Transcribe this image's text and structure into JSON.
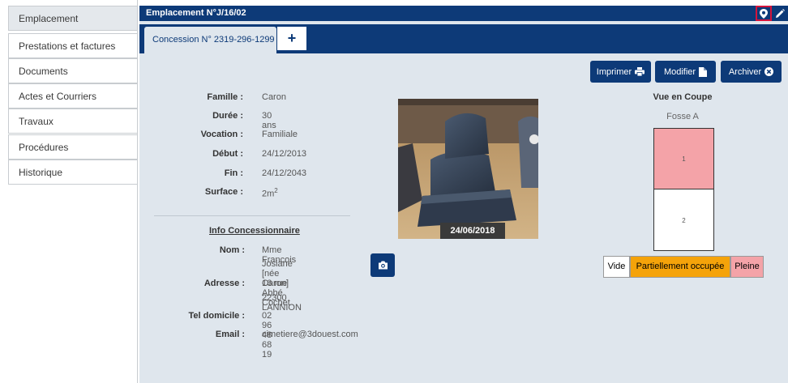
{
  "sidebar": {
    "items": [
      {
        "label": "Emplacement",
        "active": true
      },
      {
        "label": "Prestations et factures"
      },
      {
        "label": "Documents"
      },
      {
        "label": "Actes et Courriers"
      },
      {
        "label": "Travaux"
      },
      {
        "label": "Procédures"
      },
      {
        "label": "Historique"
      }
    ]
  },
  "header": {
    "title": "Emplacement N°J/16/02",
    "icons": [
      "map-pin-icon",
      "pencil-icon"
    ]
  },
  "tabs": {
    "active_label": "Concession N° 2319-296-1299",
    "add_label": "+"
  },
  "toolbar": {
    "print_label": "Imprimer",
    "edit_label": "Modifier",
    "archive_label": "Archiver"
  },
  "concession": {
    "famille_label": "Famille :",
    "famille": "Caron",
    "duree_label": "Durée :",
    "duree": "30 ans",
    "vocation_label": "Vocation :",
    "vocation": "Familiale",
    "debut_label": "Début :",
    "debut": "24/12/2013",
    "fin_label": "Fin :",
    "fin": "24/12/2043",
    "surface_label": "Surface :",
    "surface": "2m",
    "surface_exp": "2"
  },
  "concessionnaire": {
    "section_title": "Info Concessionnaire",
    "nom_label": "Nom :",
    "nom_line1": "Mme Francois",
    "nom_line2": "Josiane [née Caron]",
    "adresse_label": "Adresse :",
    "adresse_line1": "16 rue Abbé Cochet",
    "adresse_line2": "22300 LANNION",
    "tel_label": "Tel domicile :",
    "tel": "02 96 48 68 19",
    "email_label": "Email :",
    "email": "cimetiere@3douest.com"
  },
  "photo": {
    "date": "24/06/2018"
  },
  "coupe": {
    "title": "Vue en Coupe",
    "fosse": "Fosse A",
    "cells": [
      "1",
      "2"
    ]
  },
  "legend": {
    "vide": "Vide",
    "partielle": "Partiellement occupée",
    "pleine": "Pleine"
  },
  "colors": {
    "navy": "#0d3a78",
    "partielle": "#f5a30a",
    "pleine": "#f4a3a8"
  }
}
